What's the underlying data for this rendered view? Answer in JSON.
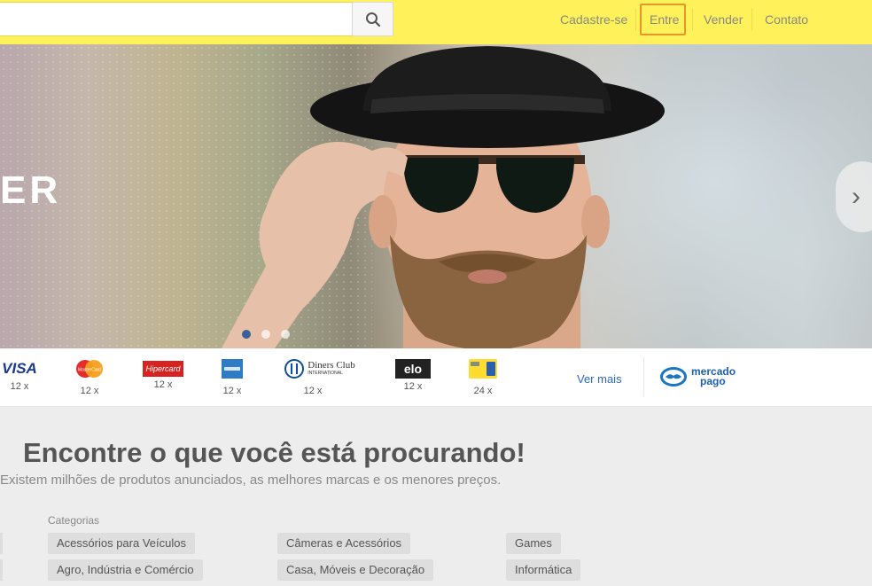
{
  "header": {
    "search": {
      "placeholder": ""
    },
    "nav": [
      {
        "label": "Cadastre-se"
      },
      {
        "label": "Entre"
      },
      {
        "label": "Vender"
      },
      {
        "label": "Contato"
      }
    ],
    "colors": {
      "bar": "#fff159",
      "highlight": "#e8952a"
    }
  },
  "hero": {
    "visible_text": "ER",
    "slides": {
      "count": 3,
      "active_index": 0
    }
  },
  "payments": {
    "methods": [
      {
        "name": "VISA",
        "installments": "12 x"
      },
      {
        "name": "MasterCard",
        "installments": "12 x"
      },
      {
        "name": "Hipercard",
        "installments": "12 x"
      },
      {
        "name": "American Express",
        "installments": "12 x"
      },
      {
        "name": "Diners Club",
        "sub": "INTERNATIONAL",
        "installments": "12 x"
      },
      {
        "name": "elo",
        "installments": "12 x"
      },
      {
        "name": "Mercado Livre card",
        "installments": "24 x"
      }
    ],
    "more_link": "Ver mais",
    "mercado_pago": {
      "line1": "mercado",
      "line2": "pago"
    }
  },
  "content": {
    "headline": "Encontre o que você está procurando!",
    "subheadline": "Existem milhões de produtos anunciados, as melhores marcas e os menores preços.",
    "categories_title": "Categorias",
    "categories": [
      "Acessórios para Veículos",
      "Agro, Indústria e Comércio",
      "Câmeras e Acessórios",
      "Casa, Móveis e Decoração",
      "Games",
      "Informática"
    ]
  }
}
